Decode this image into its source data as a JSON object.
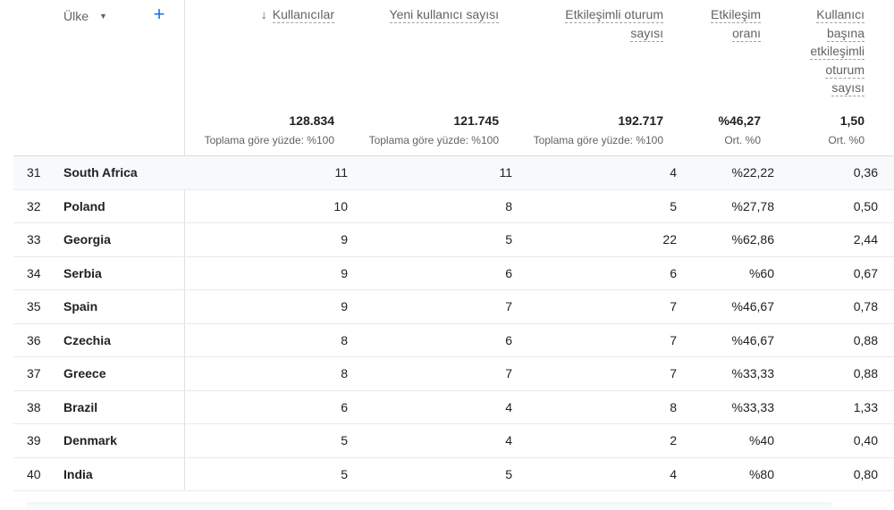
{
  "header": {
    "dimension_label": "Ülke",
    "add_label": "+",
    "columns": [
      {
        "key": "users",
        "lines": [
          "Kullanıcılar"
        ],
        "sorted": true
      },
      {
        "key": "new_users",
        "lines": [
          "Yeni kullanıcı sayısı"
        ]
      },
      {
        "key": "engaged_sessions",
        "lines": [
          "Etkileşimli oturum",
          "sayısı"
        ]
      },
      {
        "key": "engagement_rate",
        "lines": [
          "Etkileşim",
          "oranı"
        ]
      },
      {
        "key": "engaged_per_user",
        "lines": [
          "Kullanıcı",
          "başına",
          "etkileşimli",
          "oturum",
          "sayısı"
        ]
      }
    ],
    "sort_icon": "arrow-down-icon"
  },
  "totals": {
    "users": "128.834",
    "users_sub": "Toplama göre yüzde: %100",
    "new_users": "121.745",
    "new_users_sub": "Toplama göre yüzde: %100",
    "engaged_sessions": "192.717",
    "engaged_sessions_sub": "Toplama göre yüzde: %100",
    "engagement_rate": "%46,27",
    "engagement_rate_sub": "Ort. %0",
    "engaged_per_user": "1,50",
    "engaged_per_user_sub": "Ort. %0"
  },
  "rows": [
    {
      "idx": "31",
      "country": "South Africa",
      "users": "11",
      "new_users": "11",
      "engaged_sessions": "4",
      "engagement_rate": "%22,22",
      "engaged_per_user": "0,36"
    },
    {
      "idx": "32",
      "country": "Poland",
      "users": "10",
      "new_users": "8",
      "engaged_sessions": "5",
      "engagement_rate": "%27,78",
      "engaged_per_user": "0,50"
    },
    {
      "idx": "33",
      "country": "Georgia",
      "users": "9",
      "new_users": "5",
      "engaged_sessions": "22",
      "engagement_rate": "%62,86",
      "engaged_per_user": "2,44"
    },
    {
      "idx": "34",
      "country": "Serbia",
      "users": "9",
      "new_users": "6",
      "engaged_sessions": "6",
      "engagement_rate": "%60",
      "engaged_per_user": "0,67"
    },
    {
      "idx": "35",
      "country": "Spain",
      "users": "9",
      "new_users": "7",
      "engaged_sessions": "7",
      "engagement_rate": "%46,67",
      "engaged_per_user": "0,78"
    },
    {
      "idx": "36",
      "country": "Czechia",
      "users": "8",
      "new_users": "6",
      "engaged_sessions": "7",
      "engagement_rate": "%46,67",
      "engaged_per_user": "0,88"
    },
    {
      "idx": "37",
      "country": "Greece",
      "users": "8",
      "new_users": "7",
      "engaged_sessions": "7",
      "engagement_rate": "%33,33",
      "engaged_per_user": "0,88"
    },
    {
      "idx": "38",
      "country": "Brazil",
      "users": "6",
      "new_users": "4",
      "engaged_sessions": "8",
      "engagement_rate": "%33,33",
      "engaged_per_user": "1,33"
    },
    {
      "idx": "39",
      "country": "Denmark",
      "users": "5",
      "new_users": "4",
      "engaged_sessions": "2",
      "engagement_rate": "%40",
      "engaged_per_user": "0,40"
    },
    {
      "idx": "40",
      "country": "India",
      "users": "5",
      "new_users": "5",
      "engaged_sessions": "4",
      "engagement_rate": "%80",
      "engaged_per_user": "0,80"
    }
  ],
  "colors": {
    "accent": "#1a73e8",
    "row_shade": "#f8f9fa",
    "divider": "#e0e0e0"
  }
}
